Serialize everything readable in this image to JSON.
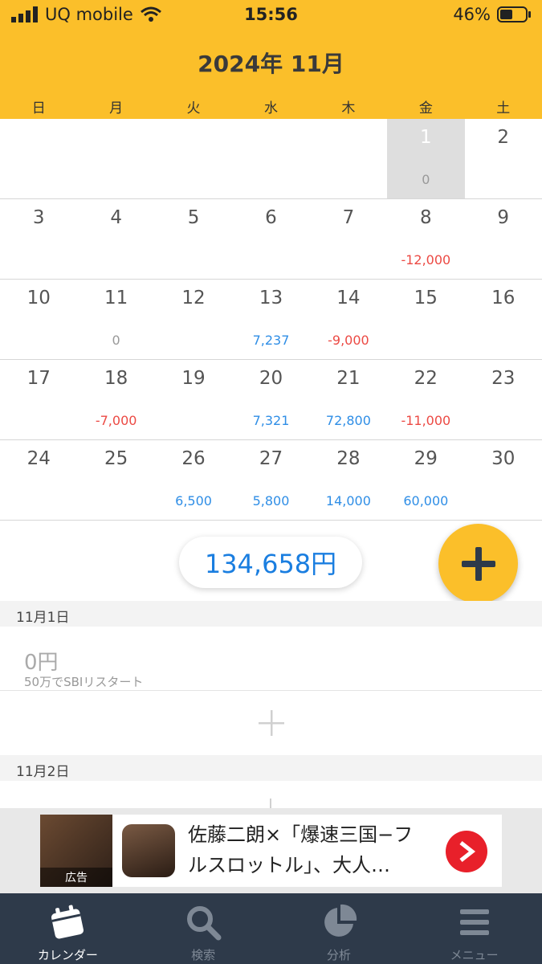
{
  "status_bar": {
    "carrier": "UQ mobile",
    "time": "15:56",
    "battery": "46%"
  },
  "header": {
    "title": "2024年 11月",
    "weekdays": [
      "日",
      "月",
      "火",
      "水",
      "木",
      "金",
      "土"
    ]
  },
  "calendar": {
    "weeks": [
      [
        {
          "day": "",
          "amount": ""
        },
        {
          "day": "",
          "amount": ""
        },
        {
          "day": "",
          "amount": ""
        },
        {
          "day": "",
          "amount": ""
        },
        {
          "day": "",
          "amount": ""
        },
        {
          "day": "1",
          "amount": "0",
          "selected": true
        },
        {
          "day": "2",
          "amount": ""
        }
      ],
      [
        {
          "day": "3",
          "amount": ""
        },
        {
          "day": "4",
          "amount": ""
        },
        {
          "day": "5",
          "amount": ""
        },
        {
          "day": "6",
          "amount": ""
        },
        {
          "day": "7",
          "amount": ""
        },
        {
          "day": "8",
          "amount": "-12,000"
        },
        {
          "day": "9",
          "amount": ""
        }
      ],
      [
        {
          "day": "10",
          "amount": ""
        },
        {
          "day": "11",
          "amount": "0"
        },
        {
          "day": "12",
          "amount": ""
        },
        {
          "day": "13",
          "amount": "7,237"
        },
        {
          "day": "14",
          "amount": "-9,000"
        },
        {
          "day": "15",
          "amount": ""
        },
        {
          "day": "16",
          "amount": ""
        }
      ],
      [
        {
          "day": "17",
          "amount": ""
        },
        {
          "day": "18",
          "amount": "-7,000"
        },
        {
          "day": "19",
          "amount": ""
        },
        {
          "day": "20",
          "amount": "7,321"
        },
        {
          "day": "21",
          "amount": "72,800"
        },
        {
          "day": "22",
          "amount": "-11,000"
        },
        {
          "day": "23",
          "amount": ""
        }
      ],
      [
        {
          "day": "24",
          "amount": ""
        },
        {
          "day": "25",
          "amount": ""
        },
        {
          "day": "26",
          "amount": "6,500"
        },
        {
          "day": "27",
          "amount": "5,800"
        },
        {
          "day": "28",
          "amount": "14,000"
        },
        {
          "day": "29",
          "amount": "60,000"
        },
        {
          "day": "30",
          "amount": ""
        }
      ]
    ]
  },
  "total": "134,658円",
  "sections": [
    {
      "date": "11月1日",
      "entry_amount": "0円",
      "entry_memo": "50万でSBIリスタート"
    },
    {
      "date": "11月2日"
    }
  ],
  "ad": {
    "thumb_label": "広告",
    "text": "佐藤二朗×「爆速三国−フルスロットル」、大人…"
  },
  "tabs": [
    {
      "label": "カレンダー",
      "icon": "calendar-icon",
      "active": true
    },
    {
      "label": "検索",
      "icon": "search-icon"
    },
    {
      "label": "分析",
      "icon": "pie-chart-icon"
    },
    {
      "label": "メニュー",
      "icon": "menu-icon"
    }
  ],
  "colors": {
    "accent": "#fbbf2a",
    "positive": "#2f8ee6",
    "negative": "#ec4a44",
    "tab_bar": "#2e3a4a"
  }
}
